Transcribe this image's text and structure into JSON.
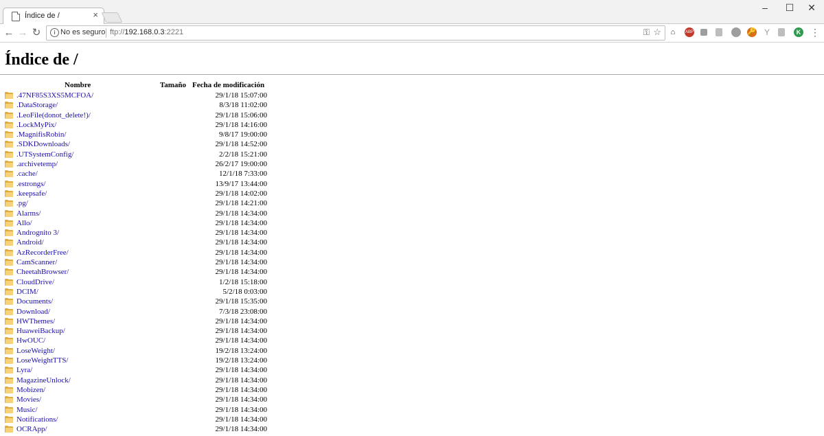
{
  "browser": {
    "tab_title": "Índice de /",
    "tab_close": "×",
    "security_label": "No es seguro",
    "url_scheme": "ftp://",
    "url_host": "192.168.0.3",
    "url_port": ":2221",
    "window_controls": {
      "minimize": "–",
      "maximize": "☐",
      "close": "✕"
    },
    "nav": {
      "back": "←",
      "forward": "→",
      "reload": "↻"
    },
    "menu_glyph": "⋮",
    "extension_k_label": "K",
    "extension_abp_label": "ABP"
  },
  "page": {
    "title": "Índice de /",
    "columns": {
      "name": "Nombre",
      "size": "Tamaño",
      "date": "Fecha de modificación"
    },
    "entries": [
      {
        "name": ".47NF85S3XS5MCFOA/",
        "date": "29/1/18 15:07:00"
      },
      {
        "name": ".DataStorage/",
        "date": "8/3/18 11:02:00"
      },
      {
        "name": ".LeoFile(donot_delete!)/",
        "date": "29/1/18 15:06:00"
      },
      {
        "name": ".LockMyPix/",
        "date": "29/1/18 14:16:00"
      },
      {
        "name": ".MagnifisRobin/",
        "date": "9/8/17 19:00:00"
      },
      {
        "name": ".SDKDownloads/",
        "date": "29/1/18 14:52:00"
      },
      {
        "name": ".UTSystemConfig/",
        "date": "2/2/18 15:21:00"
      },
      {
        "name": ".archivetemp/",
        "date": "26/2/17 19:00:00"
      },
      {
        "name": ".cache/",
        "date": "12/1/18 7:33:00"
      },
      {
        "name": ".estrongs/",
        "date": "13/9/17 13:44:00"
      },
      {
        "name": ".keepsafe/",
        "date": "29/1/18 14:02:00"
      },
      {
        "name": ".pg/",
        "date": "29/1/18 14:21:00"
      },
      {
        "name": "Alarms/",
        "date": "29/1/18 14:34:00"
      },
      {
        "name": "Allo/",
        "date": "29/1/18 14:34:00"
      },
      {
        "name": "Andrognito 3/",
        "date": "29/1/18 14:34:00"
      },
      {
        "name": "Android/",
        "date": "29/1/18 14:34:00"
      },
      {
        "name": "AzRecorderFree/",
        "date": "29/1/18 14:34:00"
      },
      {
        "name": "CamScanner/",
        "date": "29/1/18 14:34:00"
      },
      {
        "name": "CheetahBrowser/",
        "date": "29/1/18 14:34:00"
      },
      {
        "name": "CloudDrive/",
        "date": "1/2/18 15:18:00"
      },
      {
        "name": "DCIM/",
        "date": "5/2/18 0:03:00"
      },
      {
        "name": "Documents/",
        "date": "29/1/18 15:35:00"
      },
      {
        "name": "Download/",
        "date": "7/3/18 23:08:00"
      },
      {
        "name": "HWThemes/",
        "date": "29/1/18 14:34:00"
      },
      {
        "name": "HuaweiBackup/",
        "date": "29/1/18 14:34:00"
      },
      {
        "name": "HwOUC/",
        "date": "29/1/18 14:34:00"
      },
      {
        "name": "LoseWeight/",
        "date": "19/2/18 13:24:00"
      },
      {
        "name": "LoseWeightTTS/",
        "date": "19/2/18 13:24:00"
      },
      {
        "name": "Lyra/",
        "date": "29/1/18 14:34:00"
      },
      {
        "name": "MagazineUnlock/",
        "date": "29/1/18 14:34:00"
      },
      {
        "name": "Mobizen/",
        "date": "29/1/18 14:34:00"
      },
      {
        "name": "Movies/",
        "date": "29/1/18 14:34:00"
      },
      {
        "name": "Music/",
        "date": "29/1/18 14:34:00"
      },
      {
        "name": "Notifications/",
        "date": "29/1/18 14:34:00"
      },
      {
        "name": "OCRApp/",
        "date": "29/1/18 14:34:00"
      }
    ]
  },
  "colors": {
    "link": "#1a0dab",
    "folder": "#e0ad3c",
    "ext_green": "#2e9b4e",
    "ext_orange": "#d8701a"
  }
}
